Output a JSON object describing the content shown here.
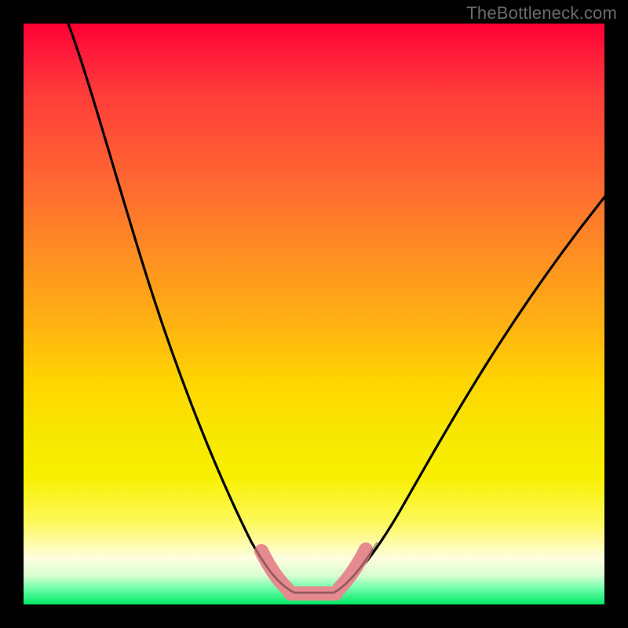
{
  "watermark": {
    "text": "TheBottleneck.com"
  },
  "chart_data": {
    "type": "line",
    "title": "",
    "xlabel": "",
    "ylabel": "",
    "xlim": [
      0,
      100
    ],
    "ylim": [
      0,
      100
    ],
    "grid": false,
    "legend": false,
    "description": "V-shaped bottleneck curve over a vertical rainbow (red→green) gradient. The curve descends from top-left, reaches a flat minimum near the bottom center, then rises toward the right edge. A pink marker highlights the minimum segment.",
    "series": [
      {
        "name": "bottleneck-curve",
        "color": "#000000",
        "x": [
          8,
          12,
          16,
          20,
          24,
          28,
          32,
          36,
          40,
          43,
          46,
          50,
          54,
          60,
          66,
          72,
          78,
          84,
          90,
          96,
          100
        ],
        "y": [
          100,
          90,
          80,
          70,
          60,
          50,
          40,
          30,
          20,
          12,
          6,
          2,
          2,
          6,
          14,
          24,
          34,
          44,
          54,
          64,
          70
        ]
      },
      {
        "name": "highlight-minimum",
        "color": "#e58b8f",
        "x": [
          41,
          43,
          45,
          47,
          49,
          51,
          53,
          55,
          57
        ],
        "y": [
          12,
          8,
          5,
          3,
          2,
          2,
          3,
          5,
          8
        ]
      }
    ],
    "gradient_stops": [
      {
        "pct": 0,
        "hex": "#ff0033"
      },
      {
        "pct": 25,
        "hex": "#ff6a30"
      },
      {
        "pct": 50,
        "hex": "#ffb312"
      },
      {
        "pct": 75,
        "hex": "#f8f000"
      },
      {
        "pct": 100,
        "hex": "#00e868"
      }
    ]
  }
}
